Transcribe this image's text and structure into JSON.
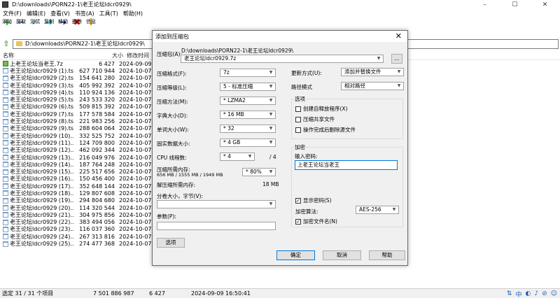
{
  "window": {
    "title": "D:\\downloads\\PORN22-1\\老王论坛ldcr0929\\",
    "controls": [
      "–",
      "☐",
      "✕"
    ]
  },
  "menu": [
    "文件(F)",
    "编辑(E)",
    "查看(V)",
    "书签(A)",
    "工具(T)",
    "帮助(H)"
  ],
  "toolbar": [
    {
      "label": "添加",
      "icon": "plus-icon",
      "glyph": "+",
      "color": "#1e9b2e"
    },
    {
      "label": "提取",
      "icon": "minus-icon",
      "glyph": "−",
      "color": "#2b5fc7"
    },
    {
      "label": "测试",
      "icon": "check-icon",
      "glyph": "✓",
      "color": "#1b9fb2"
    },
    {
      "label": "复制",
      "icon": "copy-arrow-icon",
      "glyph": "➜",
      "color": "#1b9fb2"
    },
    {
      "label": "移动",
      "icon": "move-arrow-icon",
      "glyph": "➜",
      "color": "#1a2e7a"
    },
    {
      "label": "删除",
      "icon": "delete-x-icon",
      "glyph": "✖",
      "color": "#d01818"
    },
    {
      "label": "信息",
      "icon": "info-icon",
      "glyph": "i",
      "color": "#c89a10"
    }
  ],
  "address": "D:\\downloads\\PORN22-1\\老王论坛ldcr0929\\",
  "columns": {
    "name": "名称",
    "size": "大小",
    "modified": "修改时间"
  },
  "files": [
    {
      "name": "上老王论坛当老王.7z",
      "size": "6 427",
      "date": "2024-09-09 1",
      "type": "arc"
    },
    {
      "name": "老王论坛ldcr0929 (1).ts",
      "size": "627 710 944",
      "date": "2024-10-07 1",
      "type": "doc"
    },
    {
      "name": "老王论坛ldcr0929 (2).ts",
      "size": "154 641 280",
      "date": "2024-10-07 1",
      "type": "doc"
    },
    {
      "name": "老王论坛ldcr0929 (3).ts",
      "size": "405 992 392",
      "date": "2024-10-07 1",
      "type": "doc"
    },
    {
      "name": "老王论坛ldcr0929 (4).ts",
      "size": "110 924 136",
      "date": "2024-10-07 1",
      "type": "doc"
    },
    {
      "name": "老王论坛ldcr0929 (5).ts",
      "size": "243 533 320",
      "date": "2024-10-07 1",
      "type": "doc"
    },
    {
      "name": "老王论坛ldcr0929 (6).ts",
      "size": "509 815 392",
      "date": "2024-10-07 2",
      "type": "doc"
    },
    {
      "name": "老王论坛ldcr0929 (7).ts",
      "size": "177 578 584",
      "date": "2024-10-07 1",
      "type": "doc"
    },
    {
      "name": "老王论坛ldcr0929 (8).ts",
      "size": "221 983 256",
      "date": "2024-10-07 1",
      "type": "doc"
    },
    {
      "name": "老王论坛ldcr0929 (9).ts",
      "size": "288 604 064",
      "date": "2024-10-07 1",
      "type": "doc"
    },
    {
      "name": "老王论坛ldcr0929 (10)...",
      "size": "332 525 752",
      "date": "2024-10-07 1",
      "type": "doc"
    },
    {
      "name": "老王论坛ldcr0929 (11)...",
      "size": "124 709 800",
      "date": "2024-10-07 1",
      "type": "doc"
    },
    {
      "name": "老王论坛ldcr0929 (12)...",
      "size": "462 092 344",
      "date": "2024-10-07 1",
      "type": "doc"
    },
    {
      "name": "老王论坛ldcr0929 (13)...",
      "size": "216 049 976",
      "date": "2024-10-07 1",
      "type": "doc"
    },
    {
      "name": "老王论坛ldcr0929 (14)...",
      "size": "187 764 248",
      "date": "2024-10-07 1",
      "type": "doc"
    },
    {
      "name": "老王论坛ldcr0929 (15)...",
      "size": "225 517 656",
      "date": "2024-10-07 1",
      "type": "doc"
    },
    {
      "name": "老王论坛ldcr0929 (16)...",
      "size": "150 456 400",
      "date": "2024-10-07 1",
      "type": "doc"
    },
    {
      "name": "老王论坛ldcr0929 (17)...",
      "size": "352 648 144",
      "date": "2024-10-07 1",
      "type": "doc"
    },
    {
      "name": "老王论坛ldcr0929 (18)...",
      "size": "129 807 608",
      "date": "2024-10-07 1",
      "type": "doc"
    },
    {
      "name": "老王论坛ldcr0929 (19)...",
      "size": "294 804 680",
      "date": "2024-10-07 1",
      "type": "doc"
    },
    {
      "name": "老王论坛ldcr0929 (20)...",
      "size": "114 320 544",
      "date": "2024-10-07 1",
      "type": "doc"
    },
    {
      "name": "老王论坛ldcr0929 (21)...",
      "size": "304 975 856",
      "date": "2024-10-07 1",
      "type": "doc"
    },
    {
      "name": "老王论坛ldcr0929 (22)...",
      "size": "383 494 056",
      "date": "2024-10-07 1",
      "type": "doc"
    },
    {
      "name": "老王论坛ldcr0929 (23)...",
      "size": "116 037 360",
      "date": "2024-10-07 1",
      "type": "doc"
    },
    {
      "name": "老王论坛ldcr0929 (24)...",
      "size": "267 313 816",
      "date": "2024-10-07 2",
      "type": "doc"
    },
    {
      "name": "老王论坛ldcr0929 (25)...",
      "size": "274 477 368",
      "date": "2024-10-07 2",
      "type": "doc"
    }
  ],
  "status": {
    "selected": "选定 31 / 31 个项目",
    "total_size": "7 501 886 987",
    "selected_size": "6 427",
    "date": "2024-09-09 16:50:41",
    "tray": [
      "⇅",
      "中",
      "◐",
      "♪",
      "⊘",
      "☺"
    ]
  },
  "dialog": {
    "title": "添加到压缩包",
    "close": "✕",
    "archive_label": "压缩包(A):",
    "archive_path": "D:\\downloads\\PORN22-1\\老王论坛ldcr0929\\",
    "archive_name": "老王论坛ldcr0929.7z",
    "browse": "...",
    "format_label": "压缩格式(F):",
    "format": "7z",
    "level_label": "压缩等级(L):",
    "level": "5 - 标准压缩",
    "method_label": "压缩方法(M):",
    "method": "* LZMA2",
    "dict_label": "字典大小(D):",
    "dict": "* 16 MB",
    "word_label": "单词大小(W):",
    "word": "* 32",
    "solid_label": "固实数据大小:",
    "solid": "* 4 GB",
    "threads_label": "CPU 线程数:",
    "threads": "* 4",
    "threads_max": "/ 4",
    "mem_label": "压缩所需内存:",
    "mem_detail": "656 MB / 1555 MB / 1949 MB",
    "mem_pct": "* 80%",
    "decomp_label": "解压缩所需内存:",
    "decomp_value": "18 MB",
    "split_label": "分卷大小，字节(V):",
    "params_label": "参数(P):",
    "options_button": "选项",
    "update_label": "更新方式(U):",
    "update": "添加并替换文件",
    "path_label": "路径模式",
    "path": "相对路径",
    "options_group": "选项",
    "opt_sfx": "创建自释放程序(X)",
    "opt_shared": "压缩共享文件",
    "opt_delete": "操作完成后删除源文件",
    "encrypt_group": "加密",
    "password_label": "输入密码:",
    "password": "上老王论坛当老王",
    "show_password": "显示密码(S)",
    "enc_method_label": "加密算法:",
    "enc_method": "AES-256",
    "encrypt_names": "加密文件名(N)",
    "ok": "确定",
    "cancel": "取消",
    "help": "帮助"
  }
}
